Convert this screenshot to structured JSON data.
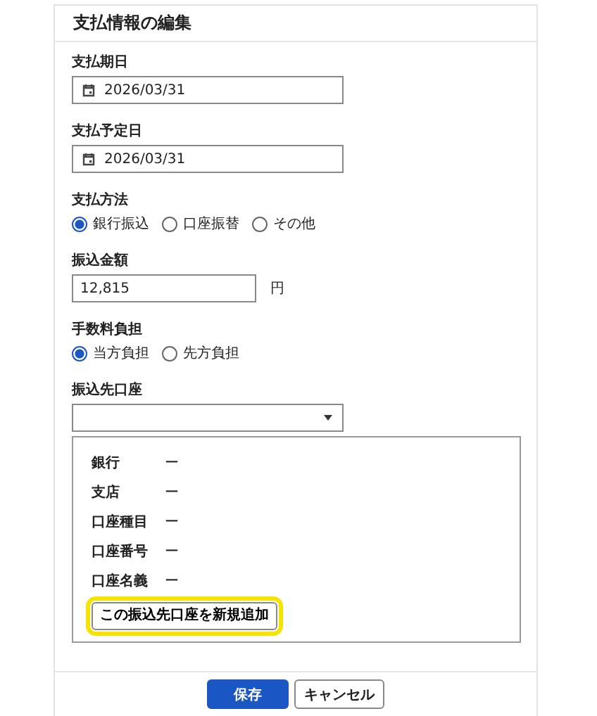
{
  "title": "支払情報の編集",
  "fields": [
    {
      "kind": "date",
      "label": "支払期日",
      "value": "2026/03/31"
    },
    {
      "kind": "date",
      "label": "支払予定日",
      "value": "2026/03/31"
    },
    {
      "kind": "radio",
      "label": "支払方法",
      "options": [
        {
          "label": "銀行振込",
          "selected": true
        },
        {
          "label": "口座振替",
          "selected": false
        },
        {
          "label": "その他",
          "selected": false
        }
      ]
    },
    {
      "kind": "amount",
      "label": "振込金額",
      "value": "12,815",
      "unit": "円"
    },
    {
      "kind": "radio",
      "label": "手数料負担",
      "options": [
        {
          "label": "当方負担",
          "selected": true
        },
        {
          "label": "先方負担",
          "selected": false
        }
      ]
    },
    {
      "kind": "select",
      "label": "振込先口座",
      "details": [
        {
          "label": "銀行",
          "value": "ー"
        },
        {
          "label": "支店",
          "value": "ー"
        },
        {
          "label": "口座種目",
          "value": "ー"
        },
        {
          "label": "口座番号",
          "value": "ー"
        },
        {
          "label": "口座名義",
          "value": "ー"
        }
      ],
      "add_button": {
        "label": "この振込先口座を新規追加",
        "highlighted": true
      }
    }
  ],
  "buttons": [
    {
      "kind": "primary",
      "label": "保存"
    },
    {
      "kind": "secondary",
      "label": "キャンセル"
    }
  ]
}
